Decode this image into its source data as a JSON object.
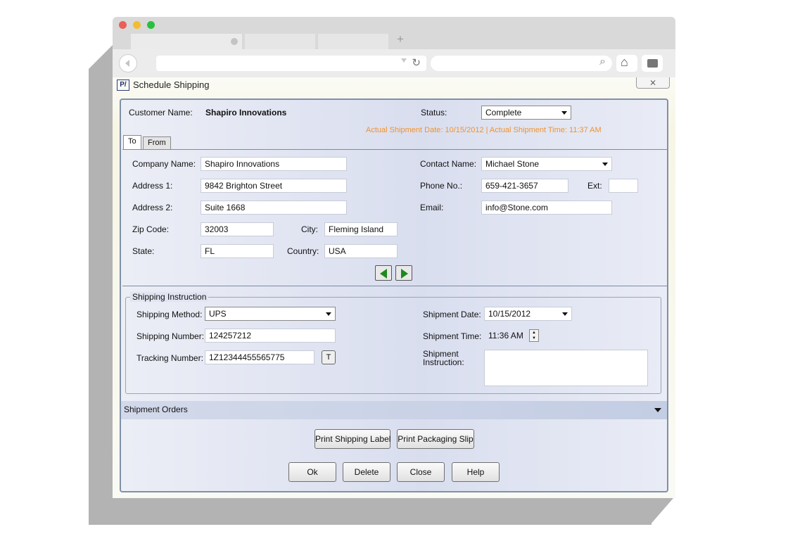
{
  "window": {
    "title": "Schedule Shipping",
    "close_glyph": "⨯",
    "icon_text": "P/"
  },
  "header": {
    "customer_label": "Customer Name:",
    "customer_value": "Shapiro Innovations",
    "status_label": "Status:",
    "status_value": "Complete",
    "actual_shipment": "Actual Shipment Date: 10/15/2012 | Actual Shipment Time: 11:37 AM"
  },
  "tabs": [
    {
      "label": "To",
      "active": true
    },
    {
      "label": "From",
      "active": false
    }
  ],
  "to": {
    "company_label": "Company Name:",
    "company_value": "Shapiro Innovations",
    "address1_label": "Address 1:",
    "address1_value": "9842 Brighton Street",
    "address2_label": "Address 2:",
    "address2_value": "Suite 1668",
    "zip_label": "Zip Code:",
    "zip_value": "32003",
    "city_label": "City:",
    "city_value": "Fleming Island",
    "state_label": "State:",
    "state_value": "FL",
    "country_label": "Country:",
    "country_value": "USA",
    "contact_label": "Contact Name:",
    "contact_value": "Michael Stone",
    "phone_label": "Phone No.:",
    "phone_value": "659-421-3657",
    "ext_label": "Ext:",
    "ext_value": "",
    "email_label": "Email:",
    "email_value": "info@Stone.com"
  },
  "shipping": {
    "group_label": "Shipping Instruction",
    "method_label": "Shipping Method:",
    "method_value": "UPS",
    "number_label": "Shipping Number:",
    "number_value": "124257212",
    "tracking_label": "Tracking Number:",
    "tracking_value": "1Z12344455565775",
    "tracking_button": "T",
    "date_label": "Shipment Date:",
    "date_value": "10/15/2012",
    "time_label": "Shipment Time:",
    "time_value": "11:36 AM",
    "instruction_label_1": "Shipment",
    "instruction_label_2": "Instruction:",
    "instruction_value": ""
  },
  "orders": {
    "label": "Shipment Orders"
  },
  "buttons": {
    "print_label": "Print Shipping Label",
    "print_slip": "Print Packaging Slip",
    "ok": "Ok",
    "delete": "Delete",
    "close": "Close",
    "help": "Help"
  },
  "browser": {
    "new_tab": "+",
    "reload_glyph": "↻",
    "search_glyph": "⌕",
    "home_glyph": "⌂"
  },
  "colors": {
    "accent_orange": "#f0922f",
    "nav_arrow_green": "#1d8a1d",
    "panel_border": "#7f90a8"
  }
}
